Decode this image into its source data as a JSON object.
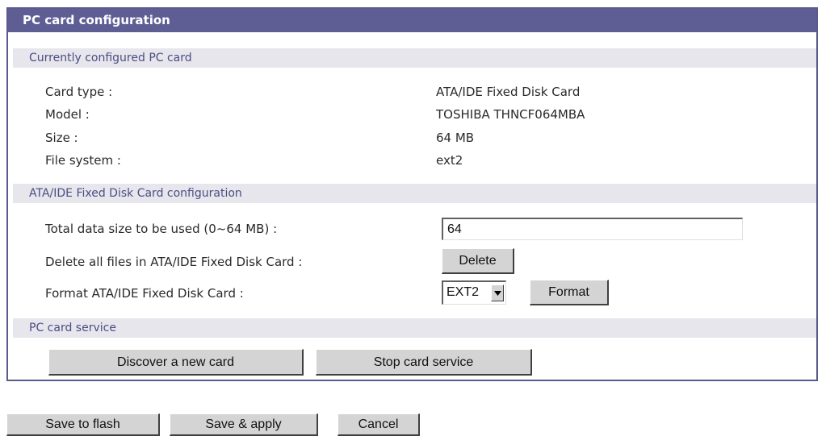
{
  "panel": {
    "title": "PC card configuration"
  },
  "current_card": {
    "heading": "Currently configured PC card",
    "rows": [
      {
        "label": "Card type :",
        "value": "ATA/IDE Fixed Disk Card"
      },
      {
        "label": "Model :",
        "value": "TOSHIBA THNCF064MBA"
      },
      {
        "label": "Size :",
        "value": "64 MB"
      },
      {
        "label": "File system :",
        "value": "ext2"
      }
    ]
  },
  "disk_config": {
    "heading": "ATA/IDE Fixed Disk Card configuration",
    "size_label": "Total data size to be used (0~64 MB) :",
    "size_value": "64",
    "delete_label": "Delete all files in ATA/IDE Fixed Disk Card :",
    "delete_button": "Delete",
    "format_label": "Format ATA/IDE Fixed Disk Card :",
    "format_select_value": "EXT2",
    "format_button": "Format"
  },
  "service": {
    "heading": "PC card service",
    "discover_button": "Discover a new card",
    "stop_button": "Stop card service"
  },
  "footer": {
    "save_flash_button": "Save to flash",
    "save_apply_button": "Save & apply",
    "cancel_button": "Cancel"
  },
  "colors": {
    "title_bar": "#5e5e94",
    "section_bar": "#e6e6ec",
    "section_text": "#4c4c84",
    "button_face": "#d4d4d4"
  }
}
